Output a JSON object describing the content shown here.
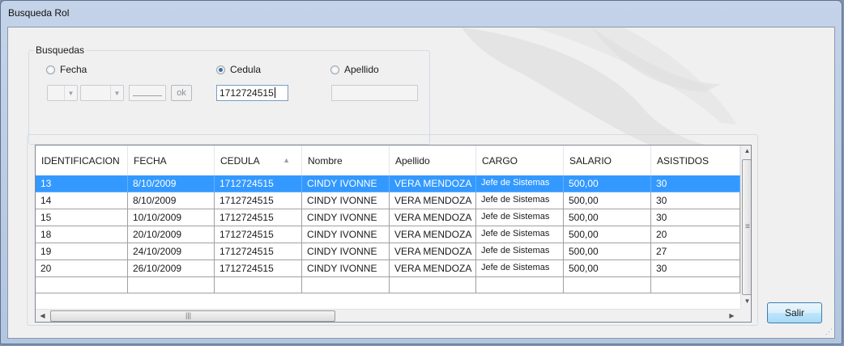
{
  "window": {
    "title": "Busqueda Rol"
  },
  "busquedas": {
    "legend": "Busquedas",
    "radios": [
      {
        "label": "Fecha",
        "checked": false
      },
      {
        "label": "Cedula",
        "checked": true
      },
      {
        "label": "Apellido",
        "checked": false
      }
    ],
    "ok_label": "ok",
    "cedula_value": "1712724515",
    "apellido_value": ""
  },
  "grid": {
    "columns": [
      "IDENTIFICACION",
      "FECHA",
      "CEDULA",
      "Nombre",
      "Apellido",
      "CARGO",
      "SALARIO",
      "ASISTIDOS"
    ],
    "sorted_column": "CEDULA",
    "sort_direction": "ascending",
    "selected_row": 0,
    "rows": [
      [
        "13",
        "8/10/2009",
        "1712724515",
        "CINDY IVONNE",
        "VERA MENDOZA",
        "Jefe de Sistemas",
        "500,00",
        "30"
      ],
      [
        "14",
        "8/10/2009",
        "1712724515",
        "CINDY IVONNE",
        "VERA MENDOZA",
        "Jefe de Sistemas",
        "500,00",
        "30"
      ],
      [
        "15",
        "10/10/2009",
        "1712724515",
        "CINDY IVONNE",
        "VERA MENDOZA",
        "Jefe de Sistemas",
        "500,00",
        "30"
      ],
      [
        "18",
        "20/10/2009",
        "1712724515",
        "CINDY IVONNE",
        "VERA MENDOZA",
        "Jefe de Sistemas",
        "500,00",
        "20"
      ],
      [
        "19",
        "24/10/2009",
        "1712724515",
        "CINDY IVONNE",
        "VERA MENDOZA",
        "Jefe de Sistemas",
        "500,00",
        "27"
      ],
      [
        "20",
        "26/10/2009",
        "1712724515",
        "CINDY IVONNE",
        "VERA MENDOZA",
        "Jefe de Sistemas",
        "500,00",
        "30"
      ]
    ]
  },
  "buttons": {
    "salir": "Salir"
  },
  "icons": {
    "radio": "radio-button-icon",
    "dropdown": "chevron-down-icon",
    "sort": "sort-ascending-icon",
    "scroll_up": "scroll-up-arrow-icon",
    "scroll_down": "scroll-down-arrow-icon",
    "scroll_left": "scroll-left-arrow-icon",
    "scroll_right": "scroll-right-arrow-icon",
    "grip": "scroll-grip-icon"
  },
  "colors": {
    "selection": "#3399ff",
    "title_bar": "#b9cbe3",
    "client_bg": "#f0f0f0",
    "button_border": "#3c7fb1"
  }
}
